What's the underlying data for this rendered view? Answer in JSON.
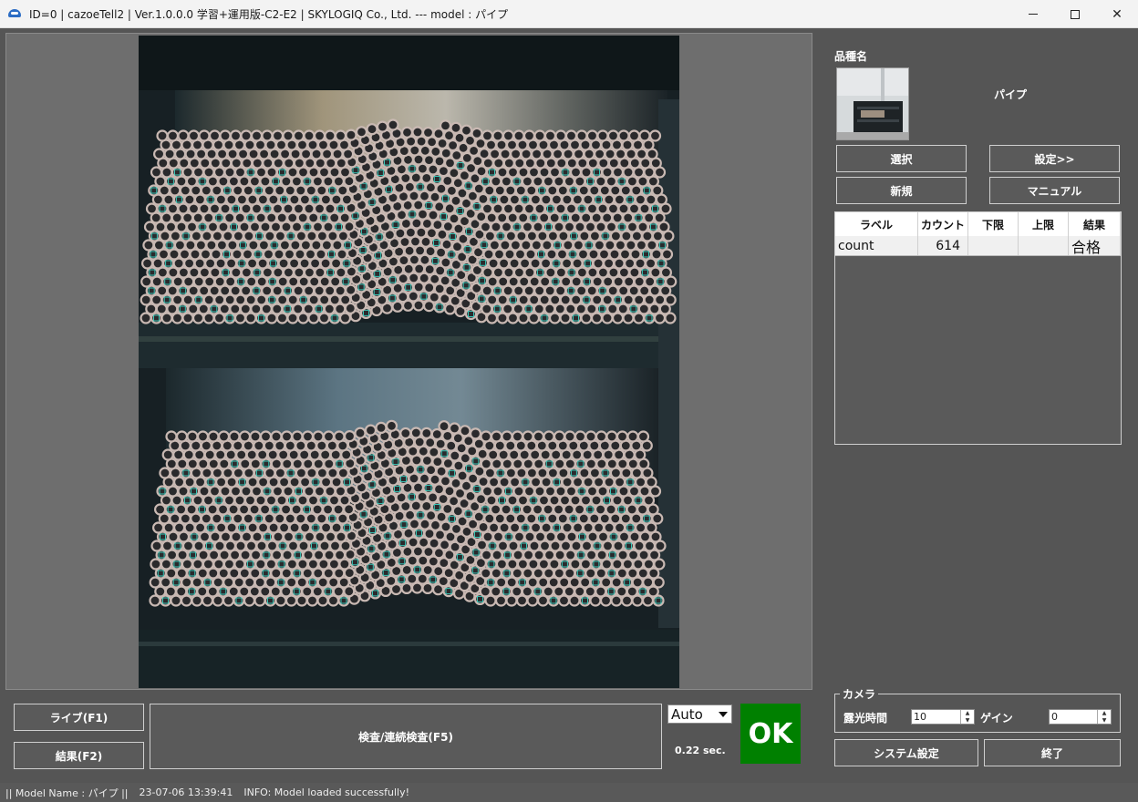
{
  "window": {
    "title": "ID=0 | cazoeTell2 | Ver.1.0.0.0 学習+運用版-C2-E2 | SKYLOGIQ Co., Ltd. --- model : パイプ",
    "app_icon": "cazoe-app-icon",
    "controls": [
      "minimize-icon",
      "maximize-icon",
      "close-icon"
    ],
    "close_glyph": "✕"
  },
  "model": {
    "label": "品種名",
    "name": "パイプ"
  },
  "buttons": {
    "select": "選択",
    "settings": "設定>>",
    "new": "新規",
    "manual": "マニュアル",
    "live": "ライブ(F1)",
    "result": "結果(F2)",
    "inspect": "検査/連続検査(F5)",
    "system_settings": "システム設定",
    "exit": "終了"
  },
  "result_table": {
    "headers": [
      "ラベル",
      "カウント",
      "下限",
      "上限",
      "結果"
    ],
    "rows": [
      {
        "label": "count",
        "count": "614",
        "lower": "",
        "upper": "",
        "result": "合格"
      }
    ]
  },
  "camera": {
    "legend": "カメラ",
    "exposure_label": "露光時間",
    "exposure_value": "10",
    "gain_label": "ゲイン",
    "gain_value": "0"
  },
  "trigger_mode": "Auto",
  "elapsed": "0.22 sec.",
  "judgement": "OK",
  "status": {
    "model": "|| Model Name : パイプ ||",
    "timestamp": "23-07-06 13:39:41",
    "message": "INFO:   Model loaded successfully!"
  },
  "colors": {
    "background": "#555555",
    "ok_green": "#008000",
    "detection_cyan": "#40e0d0"
  }
}
